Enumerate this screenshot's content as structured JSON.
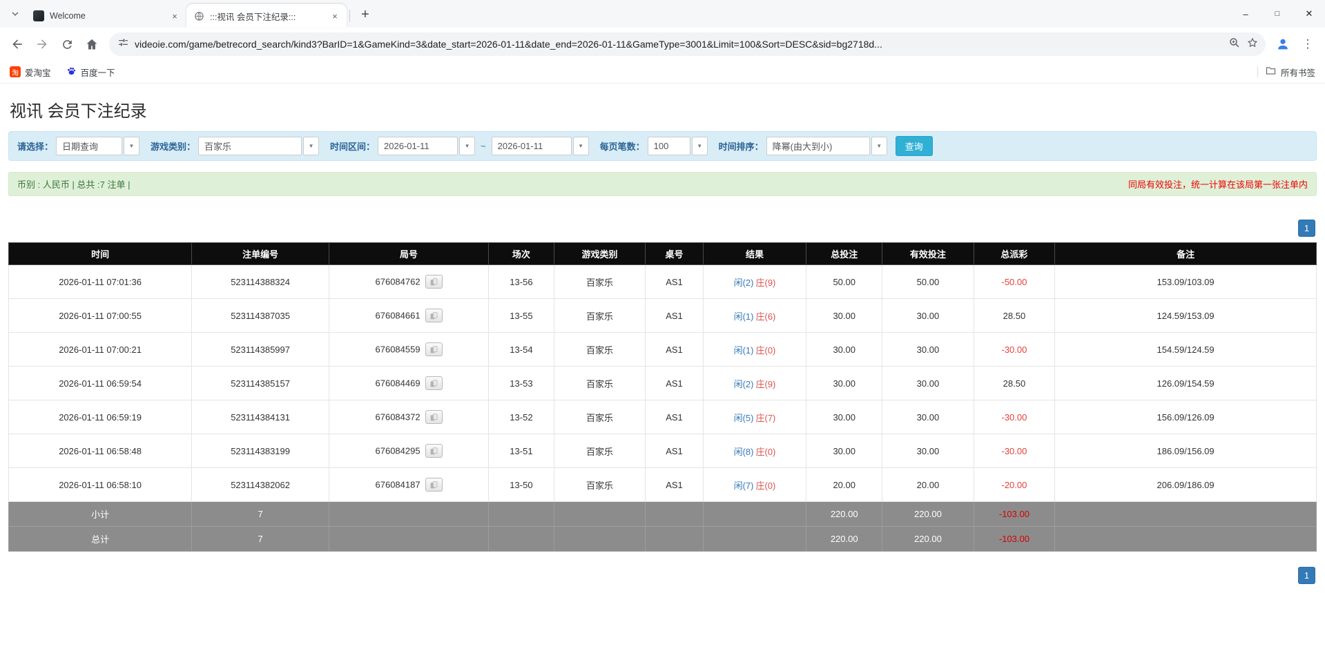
{
  "icons": {
    "tab_close": "×",
    "new_tab": "+",
    "menu": "⋮",
    "combo_arrow": "▼",
    "minimize": "–",
    "maximize": "□",
    "close": "✕"
  },
  "browser": {
    "tabs": [
      {
        "title": "Welcome"
      },
      {
        "title": ":::视讯 会员下注纪录:::"
      }
    ],
    "url": "videoie.com/game/betrecord_search/kind3?BarID=1&GameKind=3&date_start=2026-01-11&date_end=2026-01-11&GameType=3001&Limit=100&Sort=DESC&sid=bg2718d...",
    "bookmarks": {
      "taobao": "爱淘宝",
      "taobao_glyph": "淘",
      "baidu": "百度一下",
      "all": "所有书签"
    }
  },
  "page": {
    "title": "视讯 会员下注纪录",
    "filters": {
      "select_label": "请选择：",
      "select_value": "日期查询",
      "game_label": "游戏类别：",
      "game_value": "百家乐",
      "range_label": "时间区间：",
      "date_start": "2026-01-11",
      "tilde": "~",
      "date_end": "2026-01-11",
      "per_page_label": "每页笔数：",
      "per_page_value": "100",
      "sort_label": "时间排序：",
      "sort_value": "降幂(由大到小)",
      "search": "查询"
    },
    "summary": {
      "left": "币别 : 人民币 | 总共 :7 注单 |",
      "notice": "同局有效投注，统一计算在该局第一张注单内"
    },
    "pagination": {
      "page": "1"
    },
    "table": {
      "headers": [
        "时间",
        "注单编号",
        "局号",
        "场次",
        "游戏类别",
        "桌号",
        "结果",
        "总投注",
        "有效投注",
        "总派彩",
        "备注"
      ],
      "rows": [
        {
          "time": "2026-01-11 07:01:36",
          "bet_id": "523114388324",
          "round": "676084762",
          "session": "13-56",
          "game": "百家乐",
          "table_no": "AS1",
          "player": "闲(2)",
          "banker": "庄(9)",
          "total_bet": "50.00",
          "valid_bet": "50.00",
          "payout": "-50.00",
          "note": "153.09/103.09"
        },
        {
          "time": "2026-01-11 07:00:55",
          "bet_id": "523114387035",
          "round": "676084661",
          "session": "13-55",
          "game": "百家乐",
          "table_no": "AS1",
          "player": "闲(1)",
          "banker": "庄(6)",
          "total_bet": "30.00",
          "valid_bet": "30.00",
          "payout": "28.50",
          "note": "124.59/153.09"
        },
        {
          "time": "2026-01-11 07:00:21",
          "bet_id": "523114385997",
          "round": "676084559",
          "session": "13-54",
          "game": "百家乐",
          "table_no": "AS1",
          "player": "闲(1)",
          "banker": "庄(0)",
          "total_bet": "30.00",
          "valid_bet": "30.00",
          "payout": "-30.00",
          "note": "154.59/124.59"
        },
        {
          "time": "2026-01-11 06:59:54",
          "bet_id": "523114385157",
          "round": "676084469",
          "session": "13-53",
          "game": "百家乐",
          "table_no": "AS1",
          "player": "闲(2)",
          "banker": "庄(9)",
          "total_bet": "30.00",
          "valid_bet": "30.00",
          "payout": "28.50",
          "note": "126.09/154.59"
        },
        {
          "time": "2026-01-11 06:59:19",
          "bet_id": "523114384131",
          "round": "676084372",
          "session": "13-52",
          "game": "百家乐",
          "table_no": "AS1",
          "player": "闲(5)",
          "banker": "庄(7)",
          "total_bet": "30.00",
          "valid_bet": "30.00",
          "payout": "-30.00",
          "note": "156.09/126.09"
        },
        {
          "time": "2026-01-11 06:58:48",
          "bet_id": "523114383199",
          "round": "676084295",
          "session": "13-51",
          "game": "百家乐",
          "table_no": "AS1",
          "player": "闲(8)",
          "banker": "庄(0)",
          "total_bet": "30.00",
          "valid_bet": "30.00",
          "payout": "-30.00",
          "note": "186.09/156.09"
        },
        {
          "time": "2026-01-11 06:58:10",
          "bet_id": "523114382062",
          "round": "676084187",
          "session": "13-50",
          "game": "百家乐",
          "table_no": "AS1",
          "player": "闲(7)",
          "banker": "庄(0)",
          "total_bet": "20.00",
          "valid_bet": "20.00",
          "payout": "-20.00",
          "note": "206.09/186.09"
        }
      ],
      "subtotal": {
        "label": "小计",
        "count": "7",
        "total_bet": "220.00",
        "valid_bet": "220.00",
        "payout": "-103.00"
      },
      "total": {
        "label": "总计",
        "count": "7",
        "total_bet": "220.00",
        "valid_bet": "220.00",
        "payout": "-103.00"
      }
    }
  }
}
